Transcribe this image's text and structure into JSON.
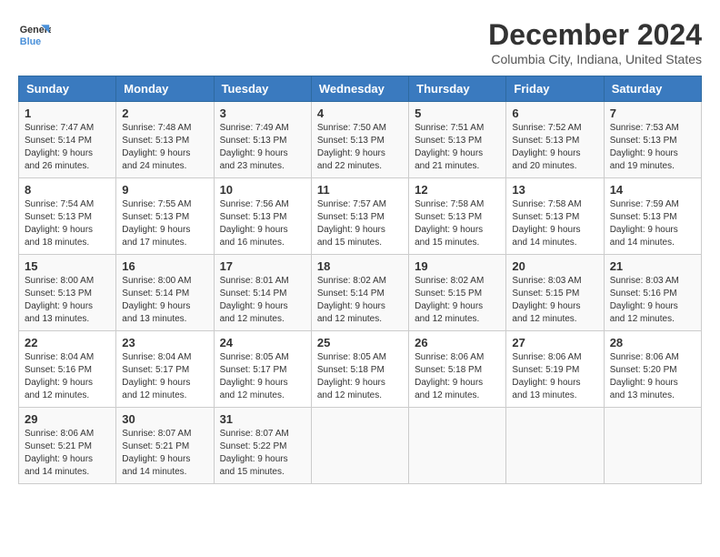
{
  "logo": {
    "line1": "General",
    "line2": "Blue"
  },
  "title": "December 2024",
  "subtitle": "Columbia City, Indiana, United States",
  "headers": [
    "Sunday",
    "Monday",
    "Tuesday",
    "Wednesday",
    "Thursday",
    "Friday",
    "Saturday"
  ],
  "weeks": [
    [
      {
        "day": "1",
        "sunrise": "7:47 AM",
        "sunset": "5:14 PM",
        "daylight": "9 hours and 26 minutes."
      },
      {
        "day": "2",
        "sunrise": "7:48 AM",
        "sunset": "5:13 PM",
        "daylight": "9 hours and 24 minutes."
      },
      {
        "day": "3",
        "sunrise": "7:49 AM",
        "sunset": "5:13 PM",
        "daylight": "9 hours and 23 minutes."
      },
      {
        "day": "4",
        "sunrise": "7:50 AM",
        "sunset": "5:13 PM",
        "daylight": "9 hours and 22 minutes."
      },
      {
        "day": "5",
        "sunrise": "7:51 AM",
        "sunset": "5:13 PM",
        "daylight": "9 hours and 21 minutes."
      },
      {
        "day": "6",
        "sunrise": "7:52 AM",
        "sunset": "5:13 PM",
        "daylight": "9 hours and 20 minutes."
      },
      {
        "day": "7",
        "sunrise": "7:53 AM",
        "sunset": "5:13 PM",
        "daylight": "9 hours and 19 minutes."
      }
    ],
    [
      {
        "day": "8",
        "sunrise": "7:54 AM",
        "sunset": "5:13 PM",
        "daylight": "9 hours and 18 minutes."
      },
      {
        "day": "9",
        "sunrise": "7:55 AM",
        "sunset": "5:13 PM",
        "daylight": "9 hours and 17 minutes."
      },
      {
        "day": "10",
        "sunrise": "7:56 AM",
        "sunset": "5:13 PM",
        "daylight": "9 hours and 16 minutes."
      },
      {
        "day": "11",
        "sunrise": "7:57 AM",
        "sunset": "5:13 PM",
        "daylight": "9 hours and 15 minutes."
      },
      {
        "day": "12",
        "sunrise": "7:58 AM",
        "sunset": "5:13 PM",
        "daylight": "9 hours and 15 minutes."
      },
      {
        "day": "13",
        "sunrise": "7:58 AM",
        "sunset": "5:13 PM",
        "daylight": "9 hours and 14 minutes."
      },
      {
        "day": "14",
        "sunrise": "7:59 AM",
        "sunset": "5:13 PM",
        "daylight": "9 hours and 14 minutes."
      }
    ],
    [
      {
        "day": "15",
        "sunrise": "8:00 AM",
        "sunset": "5:13 PM",
        "daylight": "9 hours and 13 minutes."
      },
      {
        "day": "16",
        "sunrise": "8:00 AM",
        "sunset": "5:14 PM",
        "daylight": "9 hours and 13 minutes."
      },
      {
        "day": "17",
        "sunrise": "8:01 AM",
        "sunset": "5:14 PM",
        "daylight": "9 hours and 12 minutes."
      },
      {
        "day": "18",
        "sunrise": "8:02 AM",
        "sunset": "5:14 PM",
        "daylight": "9 hours and 12 minutes."
      },
      {
        "day": "19",
        "sunrise": "8:02 AM",
        "sunset": "5:15 PM",
        "daylight": "9 hours and 12 minutes."
      },
      {
        "day": "20",
        "sunrise": "8:03 AM",
        "sunset": "5:15 PM",
        "daylight": "9 hours and 12 minutes."
      },
      {
        "day": "21",
        "sunrise": "8:03 AM",
        "sunset": "5:16 PM",
        "daylight": "9 hours and 12 minutes."
      }
    ],
    [
      {
        "day": "22",
        "sunrise": "8:04 AM",
        "sunset": "5:16 PM",
        "daylight": "9 hours and 12 minutes."
      },
      {
        "day": "23",
        "sunrise": "8:04 AM",
        "sunset": "5:17 PM",
        "daylight": "9 hours and 12 minutes."
      },
      {
        "day": "24",
        "sunrise": "8:05 AM",
        "sunset": "5:17 PM",
        "daylight": "9 hours and 12 minutes."
      },
      {
        "day": "25",
        "sunrise": "8:05 AM",
        "sunset": "5:18 PM",
        "daylight": "9 hours and 12 minutes."
      },
      {
        "day": "26",
        "sunrise": "8:06 AM",
        "sunset": "5:18 PM",
        "daylight": "9 hours and 12 minutes."
      },
      {
        "day": "27",
        "sunrise": "8:06 AM",
        "sunset": "5:19 PM",
        "daylight": "9 hours and 13 minutes."
      },
      {
        "day": "28",
        "sunrise": "8:06 AM",
        "sunset": "5:20 PM",
        "daylight": "9 hours and 13 minutes."
      }
    ],
    [
      {
        "day": "29",
        "sunrise": "8:06 AM",
        "sunset": "5:21 PM",
        "daylight": "9 hours and 14 minutes."
      },
      {
        "day": "30",
        "sunrise": "8:07 AM",
        "sunset": "5:21 PM",
        "daylight": "9 hours and 14 minutes."
      },
      {
        "day": "31",
        "sunrise": "8:07 AM",
        "sunset": "5:22 PM",
        "daylight": "9 hours and 15 minutes."
      },
      null,
      null,
      null,
      null
    ]
  ]
}
